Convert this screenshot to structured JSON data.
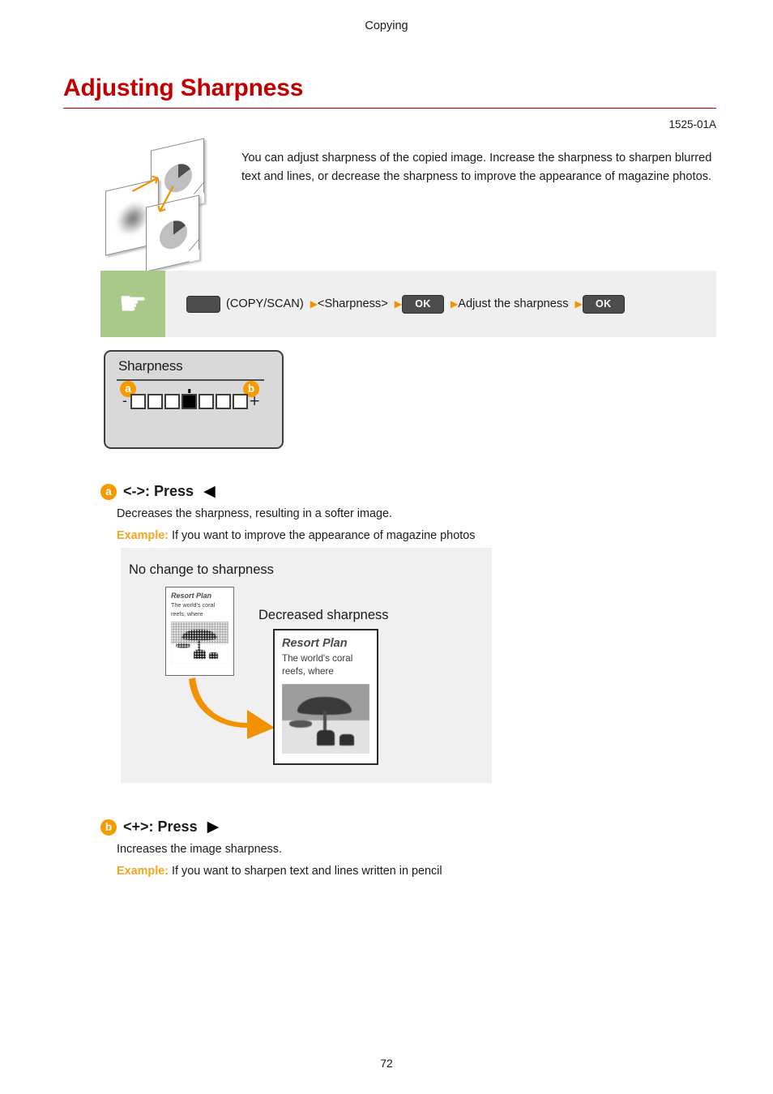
{
  "header": {
    "running_head": "Copying",
    "title": "Adjusting Sharpness",
    "doc_code": "1525-01A"
  },
  "intro": {
    "paragraph": "You can adjust sharpness of the copied image. Increase the sharpness to sharpen blurred text and lines, or decrease the sharpness to improve the appearance of magazine photos.",
    "figure_name": "sharpness-before-after-thumbnail"
  },
  "procedure": {
    "hand_icon": "pointing-hand-icon",
    "steps": [
      {
        "type": "key",
        "label": ""
      },
      {
        "type": "text",
        "label": "(COPY/SCAN)"
      },
      {
        "type": "text",
        "label": "<Sharpness>"
      },
      {
        "type": "key-ok",
        "label": "OK"
      },
      {
        "type": "text",
        "label": "Adjust the sharpness"
      },
      {
        "type": "key-ok",
        "label": "OK"
      }
    ],
    "separator_icon": "triangle-right-icon",
    "band_bg": "#efefef",
    "hand_bg": "#a8c98a"
  },
  "lcd": {
    "title": "Sharpness",
    "minus_sign": "-",
    "plus_sign": "+",
    "boxes": 7,
    "selected_index": 3,
    "badge_left": "a",
    "badge_right": "b",
    "badge_color": "#f59b00"
  },
  "options": [
    {
      "badge": "a",
      "heading": "<->: Press",
      "arrow_icon": "triangle-left-icon",
      "description": "Decreases the sharpness, resulting in a softer image.",
      "example_label": "Example:",
      "example_text": "If you want to improve the appearance of magazine photos"
    },
    {
      "badge": "b",
      "heading": "<+>: Press",
      "arrow_icon": "triangle-right-icon",
      "description": "Increases the image sharpness.",
      "example_label": "Example:",
      "example_text": "If you want to sharpen text and lines written in pencil"
    }
  ],
  "example_figure": {
    "caption_before": "No change to sharpness",
    "caption_after": "Decreased sharpness",
    "document_title": "Resort Plan",
    "document_body_line1": "The world's coral",
    "document_body_line2": "reefs, where",
    "arrow_icon": "curved-arrow-right-icon",
    "arrow_color": "#f39200",
    "background": "#f0f0f0"
  },
  "footer": {
    "page_number": "72"
  },
  "colors": {
    "title_red": "#c00000",
    "accent_orange": "#f5a623",
    "example_orange": "#f5a623"
  }
}
